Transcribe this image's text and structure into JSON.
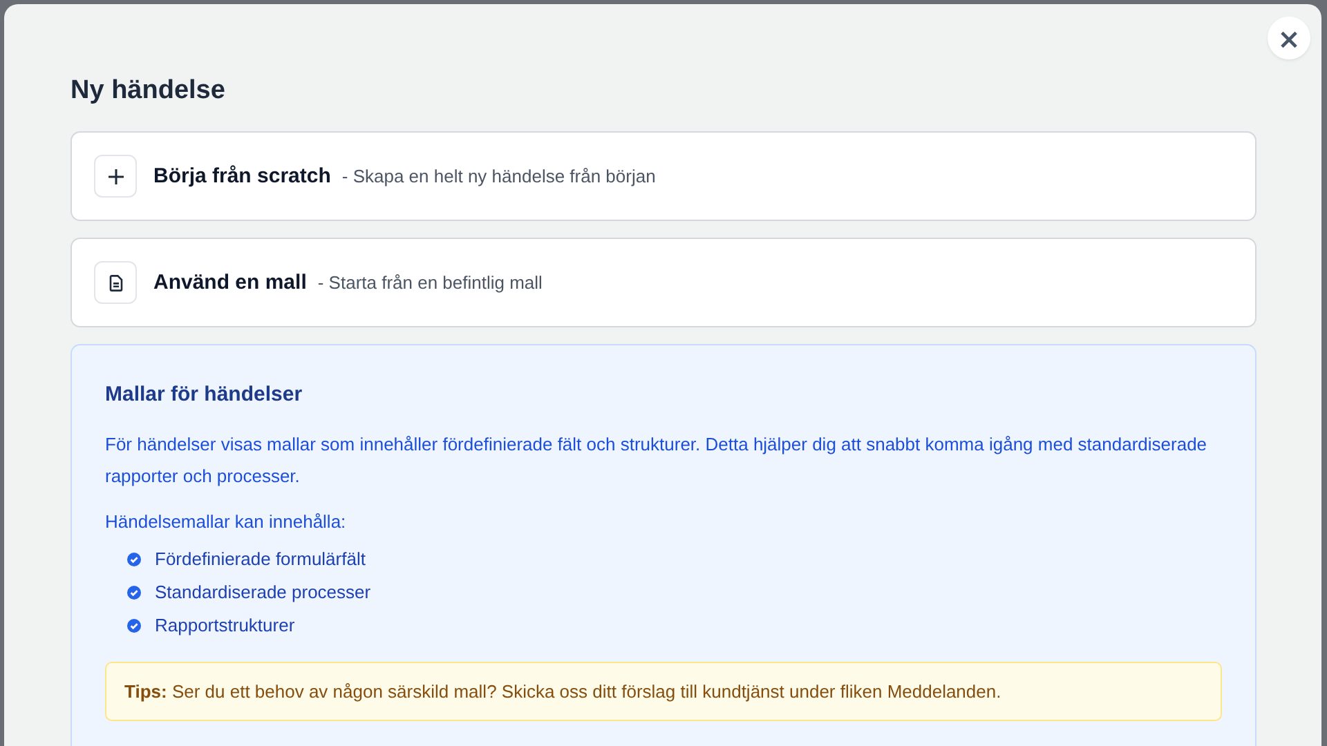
{
  "dialog": {
    "title": "Ny händelse",
    "close_label": "×"
  },
  "options": [
    {
      "kind": "plus",
      "title": "Börja från scratch",
      "description": "- Skapa en helt ny händelse från början"
    },
    {
      "kind": "document",
      "title": "Använd en mall",
      "description": "- Starta från en befintlig mall"
    }
  ],
  "info": {
    "heading": "Mallar för händelser",
    "paragraph": "För händelser visas mallar som innehåller fördefinierade fält och strukturer. Detta hjälper dig att snabbt komma igång med standardiserade rapporter och processer.",
    "list_intro": "Händelsemallar kan innehålla:",
    "items": [
      "Fördefinierade formulärfält",
      "Standardiserade processer",
      "Rapportstrukturer"
    ],
    "tip": "**Tips:** Ser du ett behov av någon särskild mall? Skicka oss ditt förslag till kundtjänst under fliken Meddelanden."
  }
}
